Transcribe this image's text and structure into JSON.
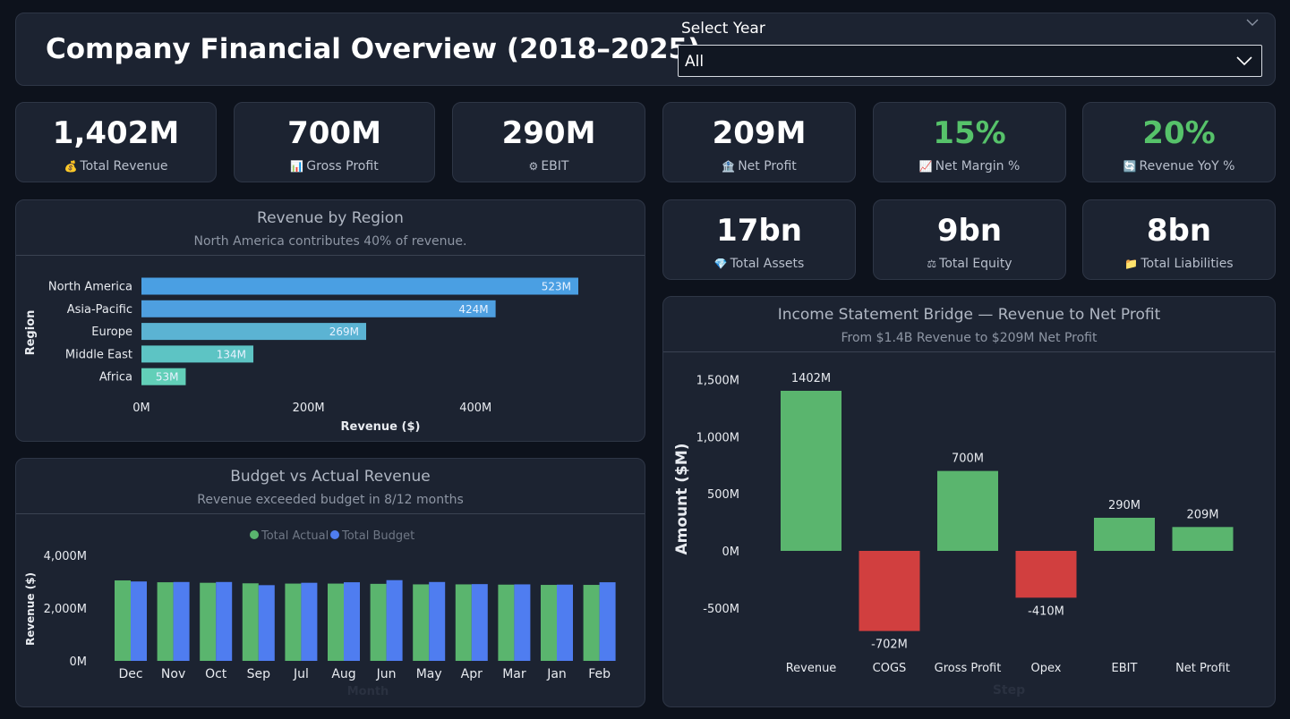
{
  "header": {
    "title": "Company Financial Overview (2018–2025)",
    "slicer_label": "Select Year",
    "slicer_value": "All"
  },
  "kpis": [
    {
      "value": "1,402M",
      "label": "Total Revenue",
      "icon": "money-bag-icon",
      "icon_glyph": "💰",
      "color": "#ffffff"
    },
    {
      "value": "700M",
      "label": "Gross Profit",
      "icon": "bar-chart-icon",
      "icon_glyph": "📊",
      "color": "#ffffff"
    },
    {
      "value": "290M",
      "label": "EBIT",
      "icon": "gear-icon",
      "icon_glyph": "⚙",
      "color": "#ffffff"
    },
    {
      "value": "209M",
      "label": "Net Profit",
      "icon": "bank-icon",
      "icon_glyph": "🏦",
      "color": "#ffffff"
    },
    {
      "value": "15%",
      "label": "Net Margin %",
      "icon": "trend-up-icon",
      "icon_glyph": "📈",
      "color": "#56c26a"
    },
    {
      "value": "20%",
      "label": "Revenue YoY %",
      "icon": "refresh-icon",
      "icon_glyph": "🔄",
      "color": "#56c26a"
    },
    {
      "value": "17bn",
      "label": "Total Assets",
      "icon": "gem-icon",
      "icon_glyph": "💎",
      "color": "#ffffff"
    },
    {
      "value": "9bn",
      "label": "Total Equity",
      "icon": "scales-icon",
      "icon_glyph": "⚖",
      "color": "#ffffff"
    },
    {
      "value": "8bn",
      "label": "Total Liabilities",
      "icon": "folder-icon",
      "icon_glyph": "📁",
      "color": "#ffffff"
    }
  ],
  "chart_data": [
    {
      "id": "region",
      "type": "bar",
      "orientation": "horizontal",
      "title": "Revenue by Region",
      "subtitle": "North America contributes 40% of revenue.",
      "xlabel": "Revenue ($)",
      "ylabel": "Region",
      "categories": [
        "North America",
        "Asia-Pacific",
        "Europe",
        "Middle East",
        "Africa"
      ],
      "values": [
        523,
        424,
        269,
        134,
        53
      ],
      "data_labels": [
        "523M",
        "424M",
        "269M",
        "134M",
        "53M"
      ],
      "colors": [
        "#4a9fe3",
        "#4e9fe0",
        "#5bb3d3",
        "#5dc4c4",
        "#62cfb8"
      ],
      "xticks": [
        "0M",
        "200M",
        "400M"
      ],
      "xtick_values": [
        0,
        200,
        400
      ],
      "xlim": [
        0,
        560
      ],
      "unit": "M"
    },
    {
      "id": "budget",
      "type": "bar",
      "title": "Budget vs Actual Revenue",
      "subtitle": "Revenue exceeded budget in 8/12 months",
      "xlabel": "Month",
      "ylabel": "Revenue ($)",
      "categories": [
        "Dec",
        "Nov",
        "Oct",
        "Sep",
        "Jul",
        "Aug",
        "Jun",
        "May",
        "Apr",
        "Mar",
        "Jan",
        "Feb"
      ],
      "series": [
        {
          "name": "Total Actual",
          "color": "#5ab56e",
          "values": [
            3050,
            2980,
            2960,
            2940,
            2930,
            2930,
            2920,
            2900,
            2900,
            2890,
            2880,
            2880
          ]
        },
        {
          "name": "Total Budget",
          "color": "#4f7df0",
          "values": [
            3010,
            2990,
            2990,
            2870,
            2960,
            2980,
            3060,
            2990,
            2910,
            2900,
            2890,
            2980
          ]
        }
      ],
      "yticks": [
        "0M",
        "2,000M",
        "4,000M"
      ],
      "ytick_values": [
        0,
        2000,
        4000
      ],
      "ylim": [
        0,
        4000
      ],
      "legend": "top-center"
    },
    {
      "id": "bridge",
      "type": "bar",
      "title": "Income Statement Bridge — Revenue to Net Profit",
      "subtitle": "From $1.4B Revenue to $209M Net Profit",
      "xlabel": "Step",
      "ylabel": "Amount ($M)",
      "categories": [
        "Revenue",
        "COGS",
        "Gross Profit",
        "Opex",
        "EBIT",
        "Net Profit"
      ],
      "values": [
        1402,
        -702,
        700,
        -410,
        290,
        209
      ],
      "data_labels": [
        "1402M",
        "-702M",
        "700M",
        "-410M",
        "290M",
        "209M"
      ],
      "positive_color": "#5ab56e",
      "negative_color": "#d13f3f",
      "yticks": [
        "-500M",
        "0M",
        "500M",
        "1,000M",
        "1,500M"
      ],
      "ytick_values": [
        -500,
        0,
        500,
        1000,
        1500
      ],
      "ylim": [
        -850,
        1600
      ]
    }
  ]
}
